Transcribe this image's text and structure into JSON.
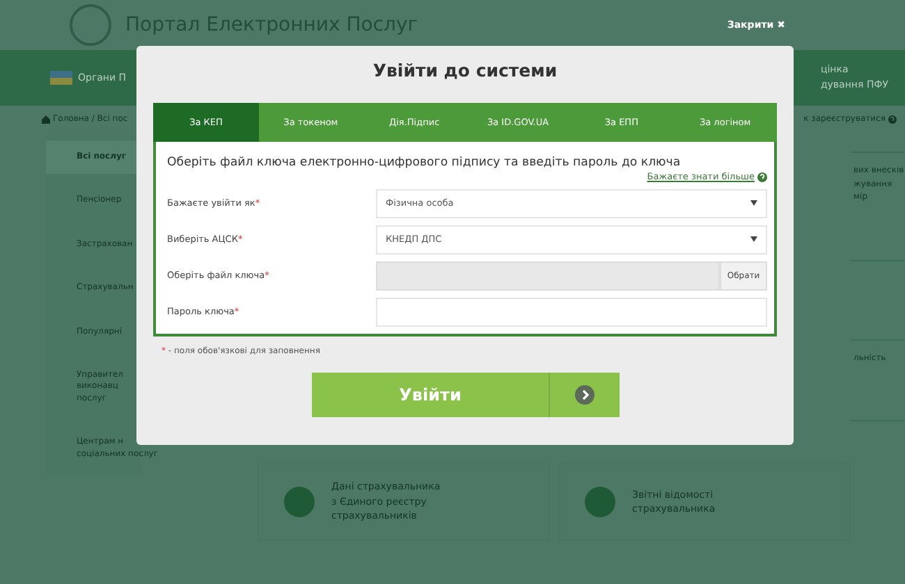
{
  "header": {
    "title": "Портал Електронних Послуг",
    "close_label": "Закрити ✖"
  },
  "nav": {
    "left_item": "Органи П",
    "right_item_lines": [
      "цінка",
      "дування ПФУ"
    ]
  },
  "breadcrumb": {
    "path": "Головна / Всі пос",
    "right_link": "к зареєструватися"
  },
  "sidebar": {
    "items": [
      {
        "lines": [
          "Всі послуг"
        ],
        "selected": true
      },
      {
        "lines": [
          "Пенсіонер"
        ],
        "selected": false
      },
      {
        "lines": [
          "Застрахован"
        ],
        "selected": false
      },
      {
        "lines": [
          "Страхувальн"
        ],
        "selected": false
      },
      {
        "lines": [
          "Популярні"
        ],
        "selected": false
      },
      {
        "lines": [
          "Управител",
          "виконавц",
          "послуг"
        ],
        "selected": false
      },
      {
        "lines": [
          "Центрам н",
          "соціальних послуг"
        ],
        "selected": false
      }
    ]
  },
  "right_cards": [
    {
      "lines": [
        "вих внесків",
        "жування",
        "мір"
      ]
    },
    {
      "lines": [
        "льність"
      ]
    }
  ],
  "cards": [
    {
      "lines": [
        "Дані страхувальника",
        "з Єдиного реєстру",
        "страхувальників"
      ]
    },
    {
      "lines": [
        "Звітні відомості",
        "страхувальника"
      ]
    }
  ],
  "modal": {
    "title": "Увійти до системи",
    "tabs": [
      {
        "label": "За КЕП",
        "selected": true
      },
      {
        "label": "За токеном",
        "selected": false
      },
      {
        "label": "Дія.Підпис",
        "selected": false
      },
      {
        "label": "За ID.GOV.UA",
        "selected": false
      },
      {
        "label": "За ЕПП",
        "selected": false
      },
      {
        "label": "За логіном",
        "selected": false
      }
    ],
    "heading": "Оберіть файл ключа електронно-цифрового підпису та введіть пароль до ключа",
    "help_link": "Бажаєте знати більше",
    "fields": [
      {
        "kind": "select",
        "label": "Бажаєте увійти як",
        "required_mark": "*",
        "value": "Фізична особа"
      },
      {
        "kind": "select",
        "label": "Виберіть АЦСК",
        "required_mark": "*",
        "value": "КНЕДП ДПС"
      },
      {
        "kind": "file",
        "label": "Оберіть файл ключа",
        "required_mark": "*",
        "button": "Обрати"
      },
      {
        "kind": "password",
        "label": "Пароль ключа",
        "required_mark": "*"
      }
    ],
    "note": {
      "mark": "*",
      "text": "- поля обов'язкові для заповнення"
    },
    "submit": "Увійти"
  }
}
